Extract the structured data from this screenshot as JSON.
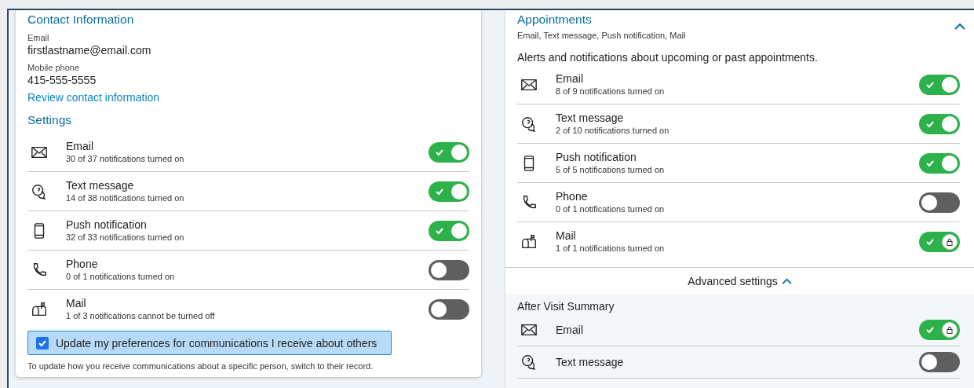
{
  "contact": {
    "title": "Contact Information",
    "fields": [
      {
        "label": "Email",
        "value": "firstlastname@email.com"
      },
      {
        "label": "Mobile phone",
        "value": "415-555-5555"
      }
    ],
    "link": "Review contact information"
  },
  "settings": {
    "title": "Settings",
    "rows": [
      {
        "kind": "email",
        "name": "Email",
        "detail": "30 of 37 notifications turned on",
        "on": true,
        "locked": false
      },
      {
        "kind": "text",
        "name": "Text message",
        "detail": "14 of 38 notifications turned on",
        "on": true,
        "locked": false
      },
      {
        "kind": "push",
        "name": "Push notification",
        "detail": "32 of 33 notifications turned on",
        "on": true,
        "locked": false
      },
      {
        "kind": "phone",
        "name": "Phone",
        "detail": "0 of 1 notifications turned on",
        "on": false,
        "locked": false
      },
      {
        "kind": "mail",
        "name": "Mail",
        "detail": "1 of 3 notifications cannot be turned off",
        "on": false,
        "locked": false
      }
    ],
    "others": {
      "label": "Update my preferences for communications I receive about others",
      "checked": true
    },
    "note": "To update how you receive communications about a specific person, switch to their record."
  },
  "appointments": {
    "title": "Appointments",
    "summary": "Email, Text message, Push notification, Mail",
    "expanded": true,
    "description": "Alerts and notifications about upcoming or past appointments.",
    "rows": [
      {
        "kind": "email",
        "name": "Email",
        "detail": "8 of 9 notifications turned on",
        "on": true,
        "locked": false
      },
      {
        "kind": "text",
        "name": "Text message",
        "detail": "2 of 10 notifications turned on",
        "on": true,
        "locked": false
      },
      {
        "kind": "push",
        "name": "Push notification",
        "detail": "5 of 5 notifications turned on",
        "on": true,
        "locked": false
      },
      {
        "kind": "phone",
        "name": "Phone",
        "detail": "0 of 1 notifications turned on",
        "on": false,
        "locked": false
      },
      {
        "kind": "mail",
        "name": "Mail",
        "detail": "1 of 1 notifications turned on",
        "on": true,
        "locked": true
      }
    ],
    "advanced": {
      "label": "Advanced settings",
      "expanded": true,
      "title": "After Visit Summary",
      "rows": [
        {
          "kind": "email",
          "name": "Email",
          "on": true,
          "locked": true
        },
        {
          "kind": "text",
          "name": "Text message",
          "on": false,
          "locked": false
        }
      ]
    }
  }
}
